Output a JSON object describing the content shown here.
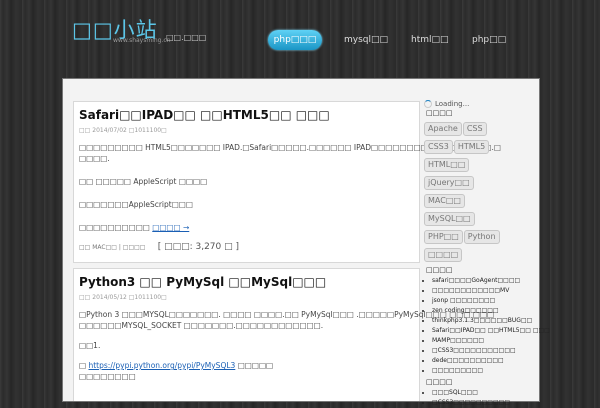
{
  "brand": {
    "name": "□□小站",
    "url": "www.shaysming.cn",
    "subtitle": "□□.□□□"
  },
  "nav": [
    {
      "label": "php□□□",
      "active": true
    },
    {
      "label": "mysql□□",
      "active": false
    },
    {
      "label": "html□□",
      "active": false
    },
    {
      "label": "php□□",
      "active": false
    }
  ],
  "posts": [
    {
      "title": "Safari□□IPAD□□ □□HTML5□□ □□□",
      "meta": "□□ 2014/07/02 □1011100□",
      "lines": [
        "□□□□□□□□□ HTML5□□□□□□□ IPAD.□Safari□□□□□.□□□□□□ IPAD□□□□□□□□□□□□□□□□□.□",
        "□□□□.",
        "□□ □□□□□ AppleScript □□□□",
        "□□□□□□□AppleScript□□□",
        "□□□□□□□□□□ □□□□ →"
      ],
      "link_text": "□□□□ →",
      "footer_tags": "□□ MAC□□ | □□□□",
      "views": "[ □□□: 3,270 □ ]"
    },
    {
      "title": "Python3 □□ PyMySql □□MySql□□□",
      "meta": "□□ 2014/05/12 □1011100□",
      "lines": [
        "□Python 3 □□□MYSQL□□□□□□□. □□□□ □□□□.□□ PyMySql□□□ .□□□□□PyMySql□□□ □□□ □□□",
        "□□□□□□MYSQL_SOCKET □□□□□□□.□□□□□□□□□□□□.",
        "□□1.",
        "□ https://pypi.python.org/pypi/PyMySQL3 □□□□□",
        "□□□□□□□□"
      ],
      "link_text": "https://pypi.python.org/pypi/PyMySQL3"
    }
  ],
  "sidebar": {
    "loading": "Loading...",
    "tags_heading": "□□□□",
    "tags": [
      "Apache",
      "CSS",
      "CSS3",
      "HTML5",
      "HTML□□",
      "jQuery□□",
      "MAC□□",
      "MySQL□□",
      "PHP□□",
      "Python",
      "□□□□"
    ],
    "recent_heading": "□□□□",
    "recent": [
      "safari□□□□GoAgent□□□□",
      "□□□□□□□□□□□□MV",
      "jsonp □□□□□□□□",
      "zen coding□□□□□□",
      "thinkphp3.1.3□□□□□□BUG□□",
      "Safari□□IPAD□□ □□HTML5□□ □□□",
      "MAMP□□□□□□",
      "□CSS3□□□□□□□□□□□",
      "dede□□□□□□□□□□",
      "□□□□□□□□□"
    ],
    "random_heading": "□□□□",
    "random": [
      "□□□SQL□□□",
      "□CSS3□□□□□□□□□□"
    ]
  }
}
